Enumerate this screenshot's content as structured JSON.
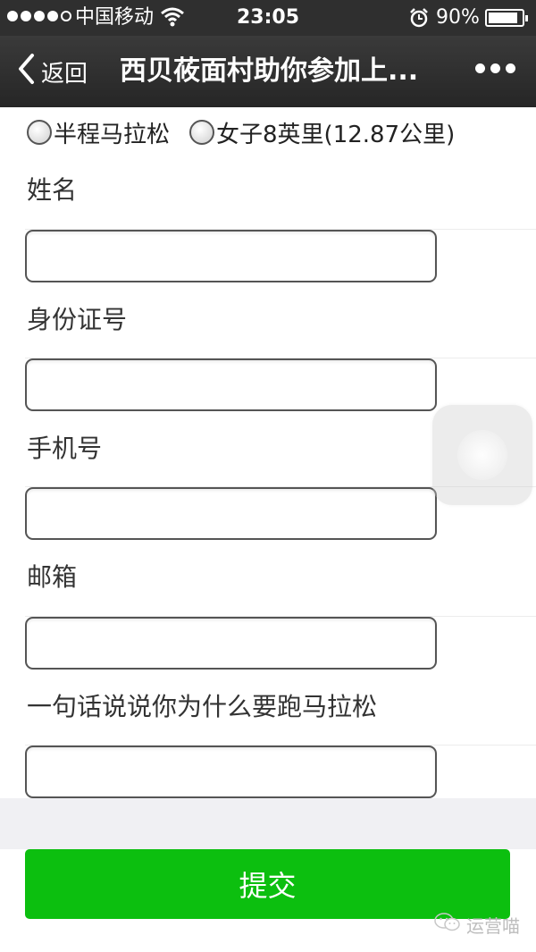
{
  "status_bar": {
    "carrier": "中国移动",
    "time": "23:05",
    "battery_text": "90%",
    "battery_level": 0.9,
    "icons": [
      "signal-dots",
      "wifi-icon",
      "alarm-icon",
      "battery-icon"
    ]
  },
  "nav": {
    "back_label": "返回",
    "title": "西贝莜面村助你参加上..."
  },
  "options": [
    {
      "label": "半程马拉松"
    },
    {
      "label": "女子8英里(12.87公里)"
    }
  ],
  "fields": [
    {
      "label": "姓名",
      "value": ""
    },
    {
      "label": "身份证号",
      "value": ""
    },
    {
      "label": "手机号",
      "value": ""
    },
    {
      "label": "邮箱",
      "value": ""
    },
    {
      "label": "一句话说说你为什么要跑马拉松",
      "value": ""
    }
  ],
  "submit_label": "提交",
  "watermark": "运营喵",
  "colors": {
    "submit_green": "#0cbf0f",
    "nav_dark": "#2f2f2f"
  }
}
